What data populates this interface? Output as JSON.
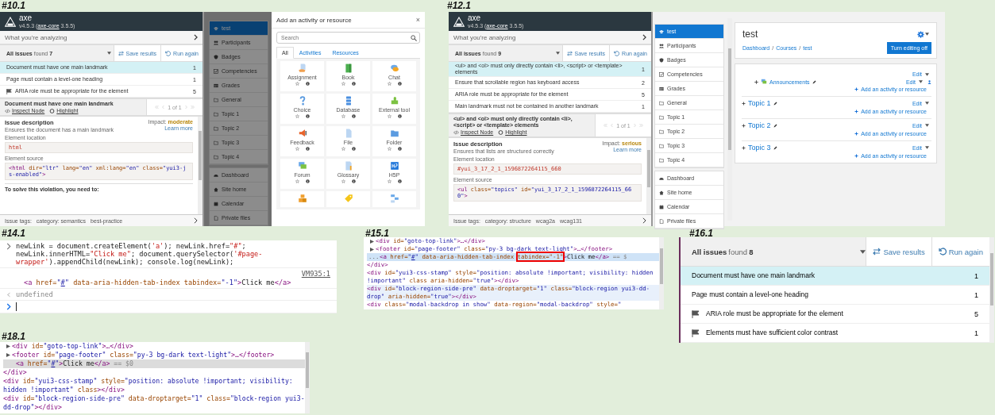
{
  "shots": [
    {
      "caption": "#10.1",
      "kind": "axe_with_modal",
      "axe": {
        "app": "axe",
        "version": {
          "before": "v4.5.3 (",
          "link": "axe-core",
          "after": " 3.5.5)"
        },
        "analyzing": "What you're analyzing",
        "issues_label": "All issues",
        "found": "found",
        "count": "7",
        "save": "Save results",
        "run": "Run again",
        "issues": [
          {
            "text": "Document must have one main landmark",
            "count": "1",
            "selected": true,
            "flagged": false
          },
          {
            "text": "Page must contain a level-one heading",
            "count": "1",
            "selected": false,
            "flagged": false
          },
          {
            "text": "ARIA role must be appropriate for the element",
            "count": "5",
            "selected": false,
            "flagged": true
          }
        ],
        "detail": {
          "title": "Document must have one main landmark",
          "inspect": "Inspect Node",
          "highlight": "Highlight",
          "pager": "1 of 1"
        },
        "description": {
          "title": "Issue description",
          "text": "Ensures the document has a main landmark",
          "impact_label": "Impact:",
          "impact": "moderate",
          "learn": "Learn more",
          "location_label": "Element location",
          "location": "html",
          "source_label": "Element source",
          "source": [
            {
              "t": "<html",
              "kind": "tag"
            },
            {
              "t": " dir=",
              "kind": "attr"
            },
            {
              "t": "\"ltr\"",
              "kind": "val"
            },
            {
              "t": " lang=",
              "kind": "attr"
            },
            {
              "t": "\"en\"",
              "kind": "val"
            },
            {
              "t": " xml:lang=",
              "kind": "attr"
            },
            {
              "t": "\"en\"",
              "kind": "val"
            },
            {
              "t": " class=",
              "kind": "attr"
            },
            {
              "t": "\"yui3-js-enabled\"",
              "kind": "val"
            },
            {
              "t": ">",
              "kind": "tag"
            }
          ],
          "solve": "To solve this violation, you need to:"
        },
        "tags_label": "Issue tags:",
        "tags": [
          "category: semantics",
          "best-practice"
        ]
      },
      "nav": {
        "dimmed": true,
        "groups": [
          {
            "items": [
              {
                "label": "test",
                "kind": "course",
                "selected": true
              },
              {
                "label": "Participants",
                "kind": "participants",
                "selected": false
              },
              {
                "label": "Badges",
                "kind": "badges",
                "selected": false
              },
              {
                "label": "Competencies",
                "kind": "competencies",
                "selected": false
              },
              {
                "label": "Grades",
                "kind": "grades",
                "selected": false
              },
              {
                "label": "General",
                "kind": "section",
                "selected": false
              },
              {
                "label": "Topic 1",
                "kind": "section",
                "selected": false
              },
              {
                "label": "Topic 2",
                "kind": "section",
                "selected": false
              },
              {
                "label": "Topic 3",
                "kind": "section",
                "selected": false
              },
              {
                "label": "Topic 4",
                "kind": "section",
                "selected": false
              }
            ]
          },
          {
            "items": [
              {
                "label": "Dashboard",
                "kind": "dashboard",
                "selected": false
              },
              {
                "label": "Site home",
                "kind": "home",
                "selected": false
              },
              {
                "label": "Calendar",
                "kind": "calendar",
                "selected": false
              },
              {
                "label": "Private files",
                "kind": "files",
                "selected": false
              }
            ]
          }
        ]
      },
      "modal": {
        "title": "Add an activity or resource",
        "close": "×",
        "search_placeholder": "Search",
        "tabs": [
          {
            "label": "All",
            "selected": true
          },
          {
            "label": "Activities",
            "selected": false
          },
          {
            "label": "Resources",
            "selected": false
          }
        ],
        "items": [
          {
            "name": "Assignment",
            "kind": "assignment"
          },
          {
            "name": "Book",
            "kind": "book"
          },
          {
            "name": "Chat",
            "kind": "chat"
          },
          {
            "name": "Choice",
            "kind": "choice"
          },
          {
            "name": "Database",
            "kind": "database"
          },
          {
            "name": "External tool",
            "kind": "external_tool"
          },
          {
            "name": "Feedback",
            "kind": "feedback"
          },
          {
            "name": "File",
            "kind": "file"
          },
          {
            "name": "Folder",
            "kind": "folder"
          },
          {
            "name": "Forum",
            "kind": "forum"
          },
          {
            "name": "Glossary",
            "kind": "glossary"
          },
          {
            "name": "H5P",
            "kind": "h5p"
          },
          {
            "kind": "boxes"
          },
          {
            "kind": "tag"
          },
          {
            "kind": "diagram"
          }
        ]
      }
    },
    {
      "caption": "#12.1",
      "kind": "axe_with_course",
      "axe": {
        "app": "axe",
        "version": {
          "before": "v4.5.3 (",
          "link": "axe-core",
          "after": " 3.5.5)"
        },
        "analyzing": "What you're analyzing",
        "issues_label": "All issues",
        "found": "found",
        "count": "9",
        "save": "Save results",
        "run": "Run again",
        "issues": [
          {
            "text": "<ul> and <ol> must only directly contain <li>, <script> or <template> elements",
            "count": "1",
            "selected": true,
            "flagged": false
          },
          {
            "text": "Ensure that scrollable region has keyboard access",
            "count": "2",
            "selected": false,
            "flagged": false
          },
          {
            "text": "ARIA role must be appropriate for the element",
            "count": "5",
            "selected": false,
            "flagged": false
          },
          {
            "text": "Main landmark must not be contained in another landmark",
            "count": "1",
            "selected": false,
            "flagged": false
          }
        ],
        "detail": {
          "title": "<ul> and <ol> must only directly contain <li>, <script> or <template> elements",
          "inspect": "Inspect Node",
          "highlight": "Highlight",
          "pager": "1 of 1"
        },
        "description": {
          "title": "Issue description",
          "text": "Ensures that lists are structured correctly",
          "impact_label": "Impact:",
          "impact": "serious",
          "learn": "Learn more",
          "location_label": "Element location",
          "location": "#yui_3_17_2_1_1596872264115_660",
          "source_label": "Element source",
          "source": [
            {
              "t": "<ul",
              "kind": "tag"
            },
            {
              "t": " class=",
              "kind": "attr"
            },
            {
              "t": "\"topics\"",
              "kind": "val"
            },
            {
              "t": " id=",
              "kind": "attr"
            },
            {
              "t": "\"yui_3_17_2_1_1596872264115_660\"",
              "kind": "val"
            },
            {
              "t": ">",
              "kind": "tag"
            }
          ]
        },
        "tags_label": "Issue tags:",
        "tags": [
          "category: structure",
          "wcag2a",
          "wcag131"
        ]
      },
      "nav": {
        "dimmed": false,
        "groups": [
          {
            "items": [
              {
                "label": "test",
                "kind": "course",
                "selected": true
              },
              {
                "label": "Participants",
                "kind": "participants",
                "selected": false
              },
              {
                "label": "Badges",
                "kind": "badges",
                "selected": false
              },
              {
                "label": "Competencies",
                "kind": "competencies",
                "selected": false
              },
              {
                "label": "Grades",
                "kind": "grades",
                "selected": false
              },
              {
                "label": "General",
                "kind": "section",
                "selected": false
              },
              {
                "label": "Topic 1",
                "kind": "section",
                "selected": false
              },
              {
                "label": "Topic 2",
                "kind": "section",
                "selected": false
              },
              {
                "label": "Topic 3",
                "kind": "section",
                "selected": false
              },
              {
                "label": "Topic 4",
                "kind": "section",
                "selected": false
              }
            ]
          },
          {
            "items": [
              {
                "label": "Dashboard",
                "kind": "dashboard",
                "selected": false
              },
              {
                "label": "Site home",
                "kind": "home",
                "selected": false
              },
              {
                "label": "Calendar",
                "kind": "calendar",
                "selected": false
              },
              {
                "label": "Private files",
                "kind": "files",
                "selected": false
              }
            ]
          }
        ]
      },
      "course": {
        "title": "test",
        "breadcrumb": [
          "Dashboard",
          "Courses",
          "test"
        ],
        "separator": "/",
        "editing_button": "Turn editing off",
        "sections": [
          {
            "edit": "Edit",
            "activities": [
              {
                "name": "Announcements",
                "edit": "Edit"
              }
            ],
            "add": "Add an activity or resource"
          },
          {
            "title": "Topic 1",
            "edit": "Edit",
            "add": "Add an activity or resource"
          },
          {
            "title": "Topic 2",
            "edit": "Edit",
            "add": "Add an activity or resource"
          },
          {
            "title": "Topic 3",
            "edit": "Edit",
            "add": "Add an activity or resource"
          }
        ]
      }
    },
    {
      "caption": "#14.1",
      "kind": "console",
      "lines": [
        {
          "kind": "input",
          "segments": [
            {
              "t": "newLink = document.createElement(",
              "kind": "plain"
            },
            {
              "t": "'a'",
              "kind": "str"
            },
            {
              "t": "); newLink.href=",
              "kind": "plain"
            },
            {
              "t": "\"#\"",
              "kind": "str"
            },
            {
              "t": "; newLink.innerHTML=",
              "kind": "plain"
            },
            {
              "t": "\"Click me\"",
              "kind": "str"
            },
            {
              "t": "; document.querySelector(",
              "kind": "plain"
            },
            {
              "t": "'#page-wrapper'",
              "kind": "str"
            },
            {
              "t": ").appendChild(newLink); console.log(newLink);",
              "kind": "plain"
            }
          ]
        },
        {
          "kind": "log",
          "source": "VM935:1",
          "segments": [
            {
              "t": "<a",
              "kind": "tag"
            },
            {
              "t": " href=",
              "kind": "attr"
            },
            {
              "t": "\"",
              "kind": "val"
            },
            {
              "t": "#",
              "kind": "link"
            },
            {
              "t": "\"",
              "kind": "val"
            },
            {
              "t": " data-aria-hidden-tab-index tabindex=",
              "kind": "attr"
            },
            {
              "t": "\"-1\"",
              "kind": "val"
            },
            {
              "t": ">",
              "kind": "tag"
            },
            {
              "t": "Click me",
              "kind": "text"
            },
            {
              "t": "</a>",
              "kind": "tag"
            }
          ]
        },
        {
          "kind": "result",
          "segments": [
            {
              "t": "undefined",
              "kind": "dim"
            }
          ]
        },
        {
          "kind": "prompt"
        }
      ]
    },
    {
      "caption": "#15.1",
      "kind": "elements",
      "lines": [
        {
          "kind": "node",
          "selected": false,
          "hovered": false,
          "segments": [
            {
              "t": "<div",
              "kind": "tag"
            },
            {
              "t": " id=",
              "kind": "attr"
            },
            {
              "t": "\"goto-top-link\"",
              "kind": "val"
            },
            {
              "t": ">…</div>",
              "kind": "tag"
            }
          ]
        },
        {
          "kind": "node",
          "selected": false,
          "hovered": false,
          "segments": [
            {
              "t": "<footer",
              "kind": "tag"
            },
            {
              "t": " id=",
              "kind": "attr"
            },
            {
              "t": "\"page-footer\"",
              "kind": "val"
            },
            {
              "t": " class=",
              "kind": "attr"
            },
            {
              "t": "\"py-3 bg-dark text-light\"",
              "kind": "val"
            },
            {
              "t": ">…</footer>",
              "kind": "tag"
            }
          ]
        },
        {
          "kind": "leaf",
          "selected": true,
          "hovered": false,
          "gutter": "...",
          "segments": [
            {
              "t": "<a",
              "kind": "tag"
            },
            {
              "t": " href=",
              "kind": "attr"
            },
            {
              "t": "\"",
              "kind": "val"
            },
            {
              "t": "#",
              "kind": "link"
            },
            {
              "t": "\"",
              "kind": "val"
            },
            {
              "t": " data-aria-hidden-tab-index ",
              "kind": "attr"
            },
            {
              "t": "tabindex=\"-1\"",
              "kind": "attr",
              "outlined": true
            },
            {
              "t": ">",
              "kind": "tag"
            },
            {
              "t": "Click me",
              "kind": "text"
            },
            {
              "t": "</a>",
              "kind": "tag"
            },
            {
              "t": " == $",
              "kind": "dim"
            }
          ]
        },
        {
          "kind": "top",
          "selected": false,
          "hovered": false,
          "segments": [
            {
              "t": "</div>",
              "kind": "tag"
            }
          ]
        },
        {
          "kind": "top",
          "selected": false,
          "hovered": false,
          "segments": [
            {
              "t": "<div",
              "kind": "tag"
            },
            {
              "t": " id=",
              "kind": "attr"
            },
            {
              "t": "\"yui3-css-stamp\"",
              "kind": "val"
            },
            {
              "t": " style=",
              "kind": "attr"
            },
            {
              "t": "\"position: absolute !important; visibility: hidden !important\"",
              "kind": "val"
            },
            {
              "t": " class aria-hidden=",
              "kind": "attr"
            },
            {
              "t": "\"true\"",
              "kind": "val"
            },
            {
              "t": "></div>",
              "kind": "tag"
            }
          ]
        },
        {
          "kind": "top",
          "selected": false,
          "hovered": true,
          "segments": [
            {
              "t": "<div",
              "kind": "tag"
            },
            {
              "t": " id=",
              "kind": "attr"
            },
            {
              "t": "\"block-region-side-pre\"",
              "kind": "val"
            },
            {
              "t": " data-droptarget=",
              "kind": "attr"
            },
            {
              "t": "\"1\"",
              "kind": "val"
            },
            {
              "t": " class=",
              "kind": "attr"
            },
            {
              "t": "\"block-region yui3-dd-drop\"",
              "kind": "val"
            },
            {
              "t": " aria-hidden=",
              "kind": "attr"
            },
            {
              "t": "\"true\"",
              "kind": "val"
            },
            {
              "t": "></div>",
              "kind": "tag"
            }
          ]
        },
        {
          "kind": "top",
          "selected": false,
          "hovered": false,
          "segments": [
            {
              "t": "<div",
              "kind": "tag"
            },
            {
              "t": " class=",
              "kind": "attr"
            },
            {
              "t": "\"modal-backdrop in show\"",
              "kind": "val"
            },
            {
              "t": " data-region=",
              "kind": "attr"
            },
            {
              "t": "\"modal-backdrop\"",
              "kind": "val"
            },
            {
              "t": " style=",
              "kind": "attr"
            },
            {
              "t": "\"",
              "kind": "val"
            }
          ]
        }
      ]
    },
    {
      "caption": "#16.1",
      "kind": "issue_list",
      "axe": {
        "issues_label": "All issues",
        "found": "found",
        "count": "8",
        "save": "Save results",
        "run": "Run again",
        "issues": [
          {
            "text": "Document must have one main landmark",
            "count": "1",
            "selected": true,
            "flagged": false
          },
          {
            "text": "Page must contain a level-one heading",
            "count": "1",
            "selected": false,
            "flagged": false
          },
          {
            "text": "ARIA role must be appropriate for the element",
            "count": "5",
            "selected": false,
            "flagged": true
          },
          {
            "text": "Elements must have sufficient color contrast",
            "count": "1",
            "selected": false,
            "flagged": true
          }
        ]
      }
    },
    {
      "caption": "#18.1",
      "kind": "elements",
      "lines": [
        {
          "kind": "node",
          "selected": false,
          "hovered": false,
          "segments": [
            {
              "t": "<div",
              "kind": "tag"
            },
            {
              "t": " id=",
              "kind": "attr"
            },
            {
              "t": "\"goto-top-link\"",
              "kind": "val"
            },
            {
              "t": ">…</div>",
              "kind": "tag"
            }
          ]
        },
        {
          "kind": "node",
          "selected": false,
          "hovered": false,
          "segments": [
            {
              "t": "<footer",
              "kind": "tag"
            },
            {
              "t": " id=",
              "kind": "attr"
            },
            {
              "t": "\"page-footer\"",
              "kind": "val"
            },
            {
              "t": " class=",
              "kind": "attr"
            },
            {
              "t": "\"py-3 bg-dark text-light\"",
              "kind": "val"
            },
            {
              "t": ">…</footer>",
              "kind": "tag"
            }
          ]
        },
        {
          "kind": "leaf",
          "selected": true,
          "hovered": false,
          "segments": [
            {
              "t": "<a",
              "kind": "tag"
            },
            {
              "t": " href=",
              "kind": "attr"
            },
            {
              "t": "\"",
              "kind": "val"
            },
            {
              "t": "#",
              "kind": "link"
            },
            {
              "t": "\"",
              "kind": "val"
            },
            {
              "t": ">",
              "kind": "tag"
            },
            {
              "t": "Click me",
              "kind": "text"
            },
            {
              "t": "</a>",
              "kind": "tag"
            },
            {
              "t": " == $0",
              "kind": "dim"
            }
          ]
        },
        {
          "kind": "top",
          "selected": false,
          "hovered": false,
          "segments": [
            {
              "t": "</div>",
              "kind": "tag"
            }
          ]
        },
        {
          "kind": "top",
          "selected": false,
          "hovered": false,
          "segments": [
            {
              "t": "<div",
              "kind": "tag"
            },
            {
              "t": " id=",
              "kind": "attr"
            },
            {
              "t": "\"yui3-css-stamp\"",
              "kind": "val"
            },
            {
              "t": " style=",
              "kind": "attr"
            },
            {
              "t": "\"position: absolute !important; visibility: hidden !important\"",
              "kind": "val"
            },
            {
              "t": " class",
              "kind": "attr"
            },
            {
              "t": "></div>",
              "kind": "tag"
            }
          ]
        },
        {
          "kind": "top",
          "selected": false,
          "hovered": false,
          "segments": [
            {
              "t": "<div",
              "kind": "tag"
            },
            {
              "t": " id=",
              "kind": "attr"
            },
            {
              "t": "\"block-region-side-pre\"",
              "kind": "val"
            },
            {
              "t": " data-droptarget=",
              "kind": "attr"
            },
            {
              "t": "\"1\"",
              "kind": "val"
            },
            {
              "t": " class=",
              "kind": "attr"
            },
            {
              "t": "\"block-region yui3-dd-drop\"",
              "kind": "val"
            },
            {
              "t": "></div>",
              "kind": "tag"
            }
          ]
        }
      ]
    }
  ]
}
